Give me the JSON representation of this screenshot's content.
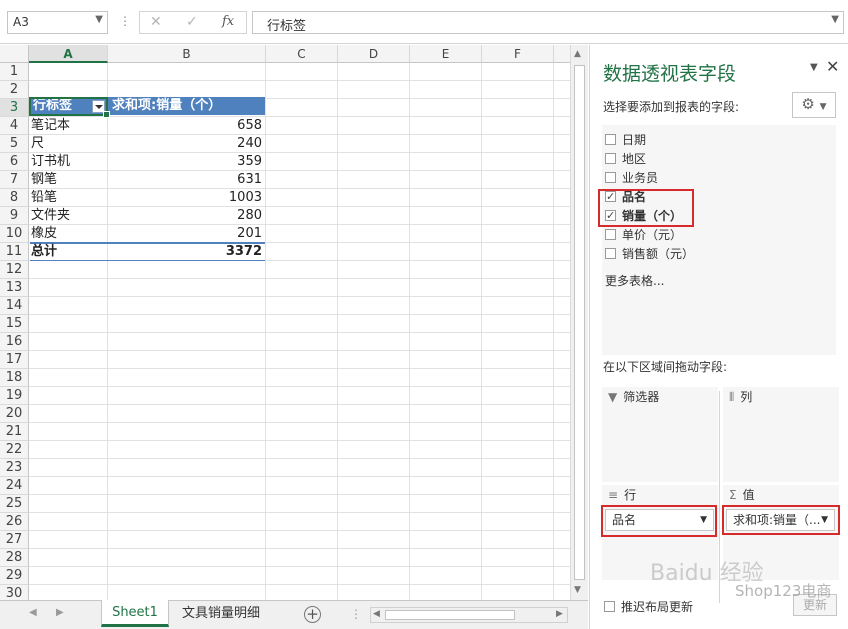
{
  "formula_bar": {
    "name_box": "A3",
    "cancel_icon": "✕",
    "enter_icon": "✓",
    "fx_label": "fx",
    "formula": "行标签"
  },
  "grid": {
    "columns": [
      "A",
      "B",
      "C",
      "D",
      "E",
      "F"
    ],
    "rows": [
      "1",
      "2",
      "3",
      "4",
      "5",
      "6",
      "7",
      "8",
      "9",
      "10",
      "11",
      "12",
      "13",
      "14",
      "15",
      "16",
      "17",
      "18",
      "19",
      "20",
      "21",
      "22",
      "23",
      "24",
      "25",
      "26",
      "27",
      "28",
      "29",
      "30"
    ],
    "pivot": {
      "header_row_label": "行标签",
      "header_value": "求和项:销量（个）",
      "items": [
        {
          "name": "笔记本",
          "value": "658"
        },
        {
          "name": "尺",
          "value": "240"
        },
        {
          "name": "订书机",
          "value": "359"
        },
        {
          "name": "钢笔",
          "value": "631"
        },
        {
          "name": "铅笔",
          "value": "1003"
        },
        {
          "name": "文件夹",
          "value": "280"
        },
        {
          "name": "橡皮",
          "value": "201"
        }
      ],
      "total_label": "总计",
      "total_value": "3372"
    }
  },
  "sheets": {
    "tabs": [
      "Sheet1",
      "文具销量明细"
    ],
    "active": "Sheet1",
    "add_icon": "+"
  },
  "pivot_pane": {
    "title": "数据透视表字段",
    "subtitle": "选择要添加到报表的字段:",
    "fields": [
      {
        "label": "日期",
        "checked": false
      },
      {
        "label": "地区",
        "checked": false
      },
      {
        "label": "业务员",
        "checked": false
      },
      {
        "label": "品名",
        "checked": true
      },
      {
        "label": "销量（个）",
        "checked": true
      },
      {
        "label": "单价（元）",
        "checked": false
      },
      {
        "label": "销售额（元）",
        "checked": false
      }
    ],
    "more_tables": "更多表格...",
    "areas_label": "在以下区域间拖动字段:",
    "areas": {
      "filters": "筛选器",
      "columns": "列",
      "rows": "行",
      "values": "值",
      "rows_chip": "品名",
      "values_chip": "求和项:销量（..."
    },
    "defer_label": "推迟布局更新",
    "update_button": "更新"
  },
  "watermark": {
    "logo": "Baidu 经验",
    "text": "Shop123电商"
  },
  "colors": {
    "excel_green": "#217346",
    "pivot_header": "#4e81bd",
    "highlight_red": "#d72a2a"
  }
}
